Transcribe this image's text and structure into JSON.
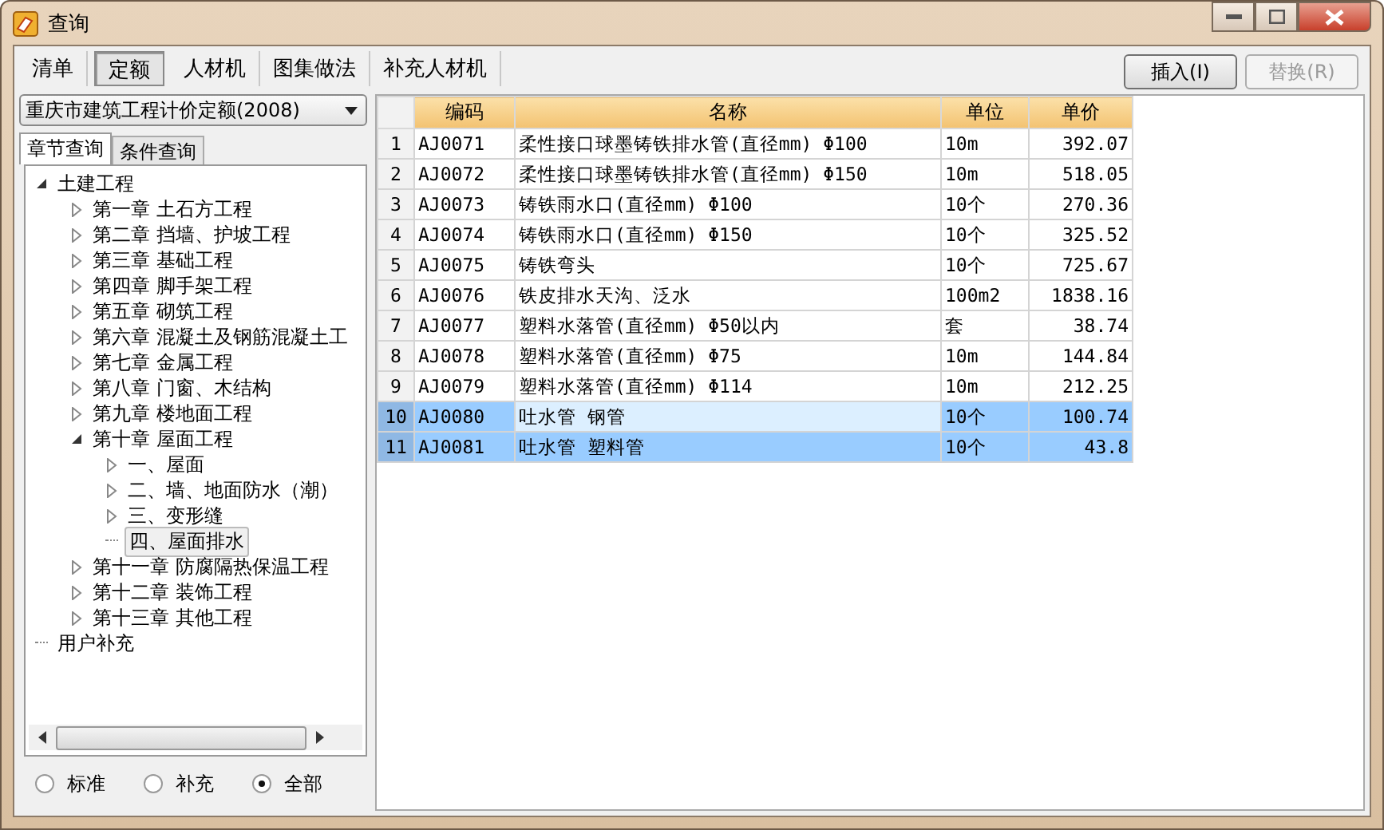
{
  "window": {
    "title": "查询"
  },
  "tabs": [
    {
      "label": "清单",
      "selected": false
    },
    {
      "label": "定额",
      "selected": true
    },
    {
      "label": "人材机",
      "selected": false
    },
    {
      "label": "图集做法",
      "selected": false
    },
    {
      "label": "补充人材机",
      "selected": false
    }
  ],
  "toolbar_buttons": [
    {
      "label": "插入(I)",
      "disabled": false
    },
    {
      "label": "替换(R)",
      "disabled": true
    }
  ],
  "quota_select": {
    "value": "重庆市建筑工程计价定额(2008)"
  },
  "sub_tabs": [
    {
      "label": "章节查询",
      "selected": true
    },
    {
      "label": "条件查询",
      "selected": false
    }
  ],
  "tree": [
    {
      "label": "土建工程",
      "expanded": true,
      "selected": false,
      "children": [
        {
          "label": "第一章  土石方工程",
          "expanded": false,
          "selected": false
        },
        {
          "label": "第二章  挡墙、护坡工程",
          "expanded": false,
          "selected": false
        },
        {
          "label": "第三章  基础工程",
          "expanded": false,
          "selected": false
        },
        {
          "label": "第四章  脚手架工程",
          "expanded": false,
          "selected": false
        },
        {
          "label": "第五章  砌筑工程",
          "expanded": false,
          "selected": false
        },
        {
          "label": "第六章  混凝土及钢筋混凝土工",
          "expanded": false,
          "selected": false
        },
        {
          "label": "第七章  金属工程",
          "expanded": false,
          "selected": false
        },
        {
          "label": "第八章  门窗、木结构",
          "expanded": false,
          "selected": false
        },
        {
          "label": "第九章  楼地面工程",
          "expanded": false,
          "selected": false
        },
        {
          "label": "第十章  屋面工程",
          "expanded": true,
          "selected": false,
          "children": [
            {
              "label": "一、屋面",
              "expanded": false,
              "selected": false
            },
            {
              "label": "二、墙、地面防水（潮）",
              "expanded": false,
              "selected": false
            },
            {
              "label": "三、变形缝",
              "expanded": false,
              "selected": false
            },
            {
              "label": "四、屋面排水",
              "selected": true
            }
          ]
        },
        {
          "label": "第十一章  防腐隔热保温工程",
          "expanded": false,
          "selected": false
        },
        {
          "label": "第十二章  装饰工程",
          "expanded": false,
          "selected": false
        },
        {
          "label": "第十三章  其他工程",
          "expanded": false,
          "selected": false
        }
      ]
    },
    {
      "label": "用户补充",
      "selected": false
    }
  ],
  "filter": [
    {
      "label": "标准",
      "selected": false
    },
    {
      "label": "补充",
      "selected": false
    },
    {
      "label": "全部",
      "selected": true
    }
  ],
  "table": {
    "columns": [
      "编码",
      "名称",
      "单位",
      "单价"
    ],
    "rows": [
      {
        "index": "1",
        "code": "AJ0071",
        "name": "柔性接口球墨铸铁排水管(直径mm) Φ100",
        "unit": "10m",
        "price": "392.07",
        "selected": false,
        "current": false
      },
      {
        "index": "2",
        "code": "AJ0072",
        "name": "柔性接口球墨铸铁排水管(直径mm) Φ150",
        "unit": "10m",
        "price": "518.05",
        "selected": false,
        "current": false
      },
      {
        "index": "3",
        "code": "AJ0073",
        "name": "铸铁雨水口(直径mm) Φ100",
        "unit": "10个",
        "price": "270.36",
        "selected": false,
        "current": false
      },
      {
        "index": "4",
        "code": "AJ0074",
        "name": "铸铁雨水口(直径mm) Φ150",
        "unit": "10个",
        "price": "325.52",
        "selected": false,
        "current": false
      },
      {
        "index": "5",
        "code": "AJ0075",
        "name": "铸铁弯头",
        "unit": "10个",
        "price": "725.67",
        "selected": false,
        "current": false
      },
      {
        "index": "6",
        "code": "AJ0076",
        "name": "铁皮排水天沟、泛水",
        "unit": "100m2",
        "price": "1838.16",
        "selected": false,
        "current": false
      },
      {
        "index": "7",
        "code": "AJ0077",
        "name": "塑料水落管(直径mm) Φ50以内",
        "unit": "套",
        "price": "38.74",
        "selected": false,
        "current": false
      },
      {
        "index": "8",
        "code": "AJ0078",
        "name": "塑料水落管(直径mm) Φ75",
        "unit": "10m",
        "price": "144.84",
        "selected": false,
        "current": false
      },
      {
        "index": "9",
        "code": "AJ0079",
        "name": "塑料水落管(直径mm) Φ114",
        "unit": "10m",
        "price": "212.25",
        "selected": false,
        "current": false
      },
      {
        "index": "10",
        "code": "AJ0080",
        "name": "吐水管 钢管",
        "unit": "10个",
        "price": "100.74",
        "selected": true,
        "current": true
      },
      {
        "index": "11",
        "code": "AJ0081",
        "name": "吐水管 塑料管",
        "unit": "10个",
        "price": "43.8",
        "selected": true,
        "current": false
      }
    ]
  }
}
